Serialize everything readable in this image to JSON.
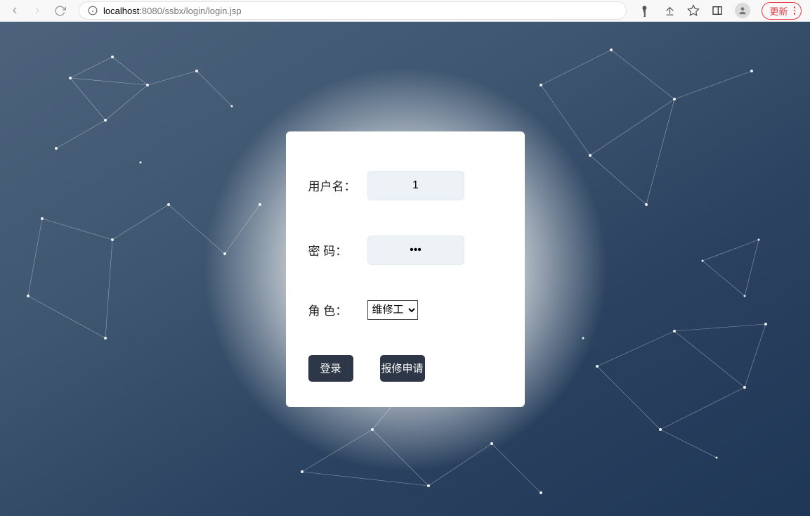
{
  "browser": {
    "url_host": "localhost",
    "url_port_path": ":8080/ssbx/login/login.jsp",
    "update_label": "更新"
  },
  "form": {
    "username_label": "用户名：",
    "username_value": "1",
    "password_label": "密  码：",
    "password_value": "•••",
    "role_label": "角  色：",
    "role_selected": "维修工",
    "login_btn": "登录",
    "report_btn": "报修申请"
  }
}
